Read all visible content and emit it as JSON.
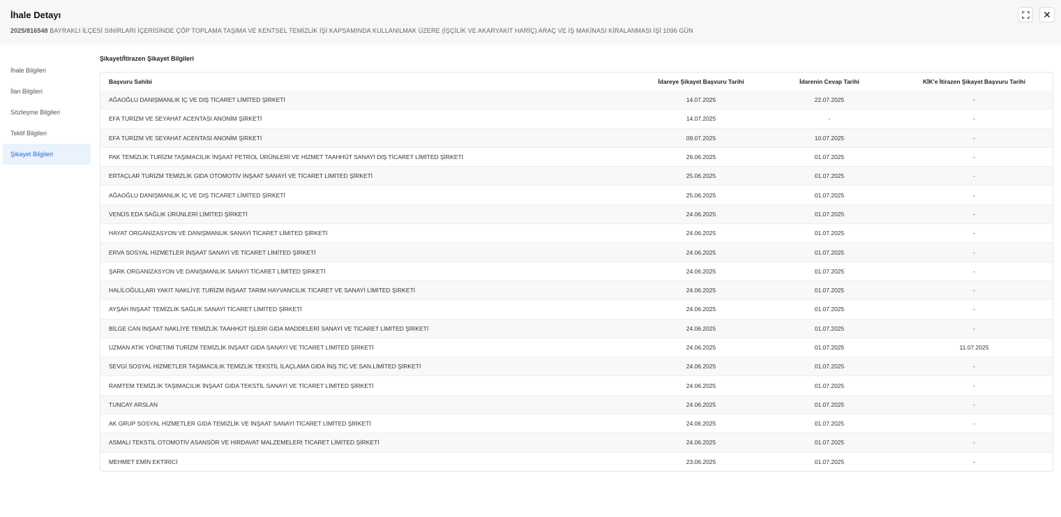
{
  "header": {
    "title": "İhale Detayı",
    "code": "2025/816548",
    "description": "BAYRAKLI İLÇESİ SINIRLARI İÇERİSİNDE ÇÖP TOPLAMA TAŞIMA VE KENTSEL TEMİZLİK İŞİ KAPSAMINDA KULLANILMAK ÜZERE (İŞÇİLİK VE AKARYAKIT HARİÇ) ARAÇ VE İŞ MAKİNASI KİRALANMASI İŞİ 1096 GÜN",
    "expand_icon": "expand-icon",
    "close_icon": "close-icon"
  },
  "sidebar": {
    "items": [
      {
        "label": "İhale Bilgileri"
      },
      {
        "label": "İlan Bilgileri"
      },
      {
        "label": "Sözleşme Bilgileri"
      },
      {
        "label": "Teklif Bilgileri"
      },
      {
        "label": "Şikayet Bilgileri"
      }
    ],
    "active_index": 4,
    "active_color": "#1a6fd6"
  },
  "section": {
    "title": "Şikayet/İtirazen Şikayet Bilgileri"
  },
  "table": {
    "columns": [
      "Başvuru Sahibi",
      "İdareye Şikayet Başvuru Tarihi",
      "İdarenin Cevap Tarihi",
      "KİK'e İtirazen Şikayet Başvuru Tarihi"
    ],
    "rows": [
      [
        "AĞAOĞLU DANIŞMANLIK İÇ VE DIŞ TİCARET LİMİTED ŞİRKETİ",
        "14.07.2025",
        "22.07.2025",
        "-"
      ],
      [
        "EFA TURİZM VE SEYAHAT ACENTASI ANONİM ŞİRKETİ",
        "14.07.2025",
        "-",
        "-"
      ],
      [
        "EFA TURİZM VE SEYAHAT ACENTASI ANONİM ŞİRKETİ",
        "09.07.2025",
        "10.07.2025",
        "-"
      ],
      [
        "PAK TEMİZLİK TURİZM TAŞIMACILIK İNŞAAT PETROL ÜRÜNLERİ VE HİZMET TAAHHÜT SANAYİ DIŞ TİCARET LİMİTED ŞİRKETİ",
        "26.06.2025",
        "01.07.2025",
        "-"
      ],
      [
        "ERTAÇLAR TURİZM TEMİZLİK GIDA OTOMOTİV İNŞAAT SANAYİ VE TİCARET LİMİTED ŞİRKETİ",
        "25.06.2025",
        "01.07.2025",
        "-"
      ],
      [
        "AĞAOĞLU DANIŞMANLIK İÇ VE DIŞ TİCARET LİMİTED ŞİRKETİ",
        "25.06.2025",
        "01.07.2025",
        "-"
      ],
      [
        "VENÜS EDA SAĞLIK ÜRÜNLERİ LİMİTED ŞİRKETİ",
        "24.06.2025",
        "01.07.2025",
        "-"
      ],
      [
        "HAYAT ORGANİZASYON VE DANIŞMANLIK SANAYİ TİCARET LİMİTED ŞİRKETİ",
        "24.06.2025",
        "01.07.2025",
        "-"
      ],
      [
        "ERVA SOSYAL HİZMETLER İNŞAAT SANAYİ VE TİCARET LİMİTED ŞİRKETİ",
        "24.06.2025",
        "01.07.2025",
        "-"
      ],
      [
        "ŞARK ORGANİZASYON VE DANIŞMANLIK SANAYİ TİCARET LİMİTED ŞİRKETİ",
        "24.06.2025",
        "01.07.2025",
        "-"
      ],
      [
        "HALİLOĞULLARI YAKIT NAKLİYE TURİZM İNŞAAT TARIM HAYVANCILIK TİCARET VE SANAYİ LİMİTED ŞİRKETİ",
        "24.06.2025",
        "01.07.2025",
        "-"
      ],
      [
        "AYŞAH İNŞAAT TEMİZLİK SAĞLIK SANAYİ TİCARET LİMİTED ŞİRKETİ",
        "24.06.2025",
        "01.07.2025",
        "-"
      ],
      [
        "BİLGE CAN İNŞAAT NAKLİYE TEMİZLİK TAAHHÜT İŞLERİ GIDA MADDELERİ SANAYİ VE TİCARET LİMİTED ŞİRKETİ",
        "24.06.2025",
        "01.07.2025",
        "-"
      ],
      [
        "UZMAN ATIK YÖNETİMİ TURİZM TEMİZLİK İNŞAAT GIDA SANAYİ VE TİCARET LİMİTED ŞİRKETİ",
        "24.06.2025",
        "01.07.2025",
        "11.07.2025"
      ],
      [
        "SEVGİ SOSYAL HİZMETLER TAŞIMACILIK TEMİZLİK TEKSTİL İLAÇLAMA GIDA İNŞ.TİC.VE SAN.LİMİTED ŞİRKETİ",
        "24.06.2025",
        "01.07.2025",
        "-"
      ],
      [
        "RAMTEM TEMİZLİK TAŞIMACILIK İNŞAAT GIDA TEKSTİL SANAYİ VE TİCARET LİMİTED ŞİRKETİ",
        "24.06.2025",
        "01.07.2025",
        "-"
      ],
      [
        "TUNCAY ARSLAN",
        "24.06.2025",
        "01.07.2025",
        "-"
      ],
      [
        "AK GRUP SOSYAL HİZMETLER GIDA TEMİZLİK VE İNŞAAT SANAYİ TİCARET LİMİTED ŞİRKETİ",
        "24.06.2025",
        "01.07.2025",
        "-"
      ],
      [
        "ASMALI TEKSTİL OTOMOTİV ASANSÖR VE HIRDAVAT MALZEMELERİ TİCARET LİMİTED ŞİRKETİ",
        "24.06.2025",
        "01.07.2025",
        "-"
      ],
      [
        "MEHMET EMİN EKTİRİCİ",
        "23.06.2025",
        "01.07.2025",
        "-"
      ]
    ]
  }
}
